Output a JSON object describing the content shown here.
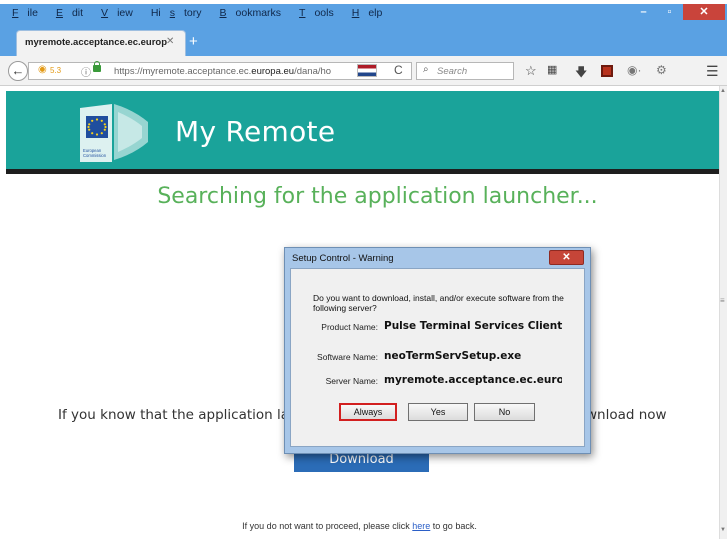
{
  "menu": {
    "items": [
      {
        "ul": "F",
        "rest": "ile"
      },
      {
        "ul": "E",
        "rest": "dit"
      },
      {
        "ul": "V",
        "rest": "iew"
      },
      {
        "pre": "Hi",
        "ul": "s",
        "rest": "tory"
      },
      {
        "ul": "B",
        "rest": "ookmarks"
      },
      {
        "ul": "T",
        "rest": "ools"
      },
      {
        "ul": "H",
        "rest": "elp"
      }
    ]
  },
  "window_controls": {
    "minimize": "–",
    "maximize": "▫",
    "close": "✕"
  },
  "tab": {
    "title": "myremote.acceptance.ec.europ",
    "close": "✕",
    "new": "+"
  },
  "nav": {
    "back": "←",
    "extension_count": "5.3",
    "url_prefix": "https://myremote.acceptance.ec.",
    "url_domain": "europa.eu",
    "url_suffix": "/dana/ho",
    "reload": "C",
    "search_placeholder": "Search",
    "toolbar_icons": [
      "star-icon",
      "clipboard-icon",
      "download-icon",
      "addon-icon",
      "pocket-icon",
      "shield-icon",
      "menu-icon"
    ]
  },
  "banner": {
    "title": "My Remote",
    "logo_line1": "European",
    "logo_line2": "Commission",
    "color": "#1aa39a"
  },
  "page": {
    "heading": "Searching for the application launcher...",
    "info_left": "If you know that the application la",
    "info_right": "wnload now",
    "download_label": "Download",
    "goback_before": "If you do not want to proceed, please click ",
    "goback_link": "here",
    "goback_after": " to go back."
  },
  "dialog": {
    "title": "Setup Control - Warning",
    "close": "✕",
    "question": "Do you want to download, install, and/or execute software from the following server?",
    "product_label": "Product Name:",
    "product_value": "Pulse Terminal Services Client",
    "software_label": "Software Name:",
    "software_value": "neoTermServSetup.exe",
    "server_label": "Server Name:",
    "server_value": "myremote.acceptance.ec.europa.eu",
    "buttons": {
      "always": "Always",
      "yes": "Yes",
      "no": "No"
    }
  }
}
